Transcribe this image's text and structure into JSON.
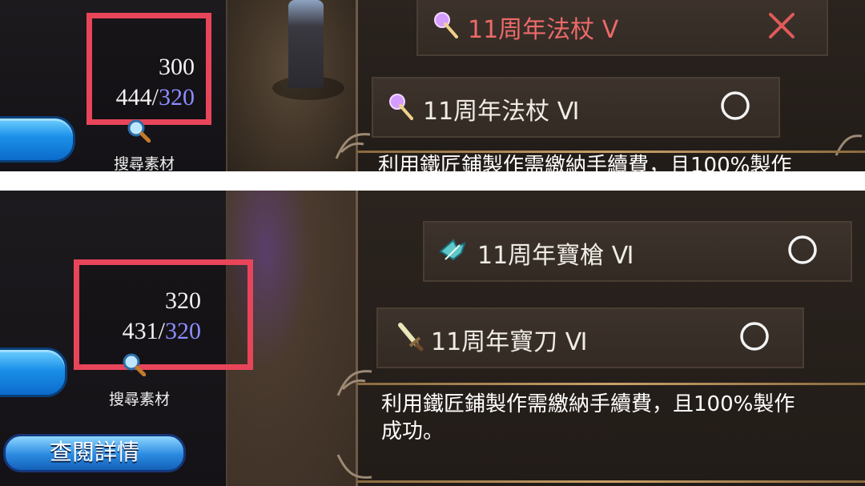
{
  "top_panel": {
    "counter": {
      "required": "300",
      "owned": "444",
      "max": "320"
    },
    "search_label": "搜尋素材",
    "items": [
      {
        "label": "11周年法杖 Ⅴ",
        "status": "cross",
        "icon": "staff-icon"
      },
      {
        "label": "11周年法杖 Ⅵ",
        "status": "circle",
        "icon": "staff-icon"
      }
    ],
    "description": "利用鐵匠鋪製作需繳納手續費，且100%製作"
  },
  "bottom_panel": {
    "counter": {
      "required": "320",
      "owned": "431",
      "max": "320"
    },
    "search_label": "搜尋素材",
    "detail_button": "查閱詳情",
    "items": [
      {
        "label": "11周年寶槍 Ⅵ",
        "status": "circle",
        "icon": "spear-icon"
      },
      {
        "label": "11周年寶刀 Ⅵ",
        "status": "circle",
        "icon": "sword-icon"
      }
    ],
    "description_line1": "利用鐵匠鋪製作需繳納手續費，且100%製作",
    "description_line2": "成功。"
  },
  "colors": {
    "highlight_box": "#e8455a",
    "max_value_blue": "#8c8cff",
    "cross_red": "#e05a5a",
    "button_blue": "#1a8fe8"
  }
}
